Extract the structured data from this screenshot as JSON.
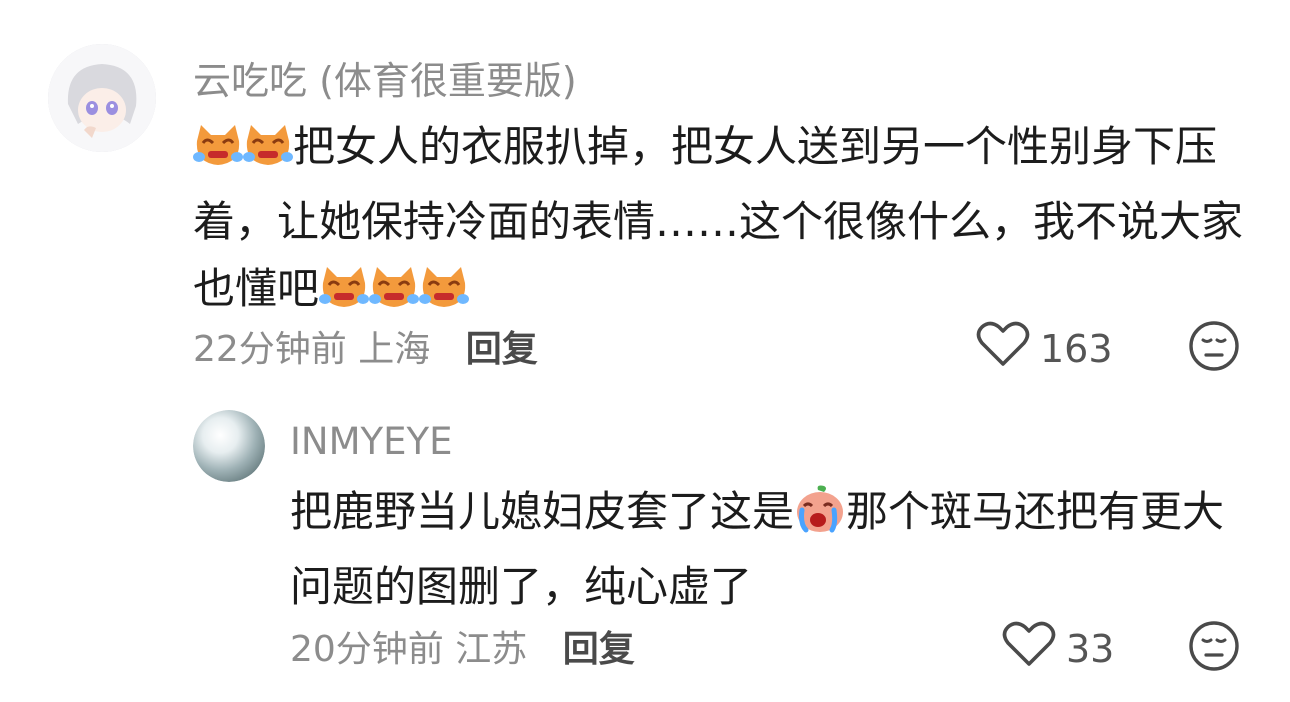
{
  "comment": {
    "author": "云吃吃 (体育很重要版)",
    "text_1": "把女人的衣服扒掉，把女人送到另一个性别身下压着，让她保持冷面的表情……这个很像什么，我不说大家也懂吧",
    "time": "22分钟前",
    "location": "上海",
    "reply_label": "回复",
    "like_count": "163"
  },
  "reply": {
    "author": "INMYEYE",
    "text_1": "把鹿野当儿媳妇皮套了这是",
    "text_2": "那个斑马还把有更大问题的图删了，纯心虚了",
    "time": "20分钟前",
    "location": "江苏",
    "reply_label": "回复",
    "like_count": "33"
  },
  "icons": {
    "cat_emoji": "crying-cat-emoji",
    "crying_emoji": "crying-face-emoji",
    "heart": "heart-outline-icon",
    "dislike": "meh-face-icon"
  }
}
